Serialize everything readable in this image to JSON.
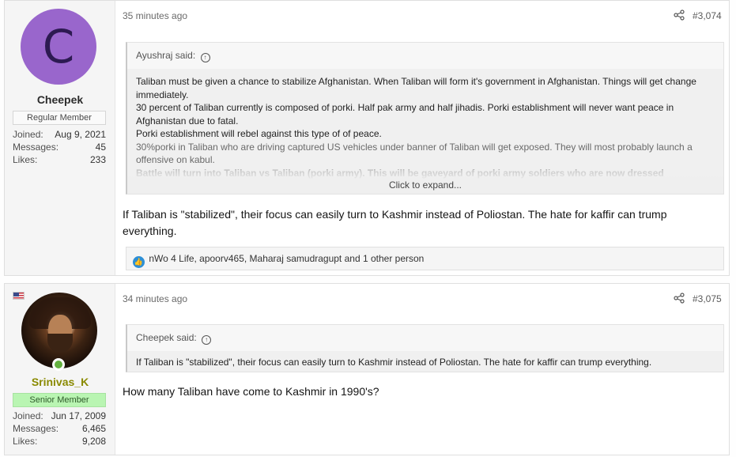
{
  "posts": [
    {
      "author": {
        "avatar_letter": "C",
        "avatar_color": "#9966cc",
        "username": "Cheepek",
        "title": "Regular Member",
        "joined_label": "Joined:",
        "joined": "Aug 9, 2021",
        "messages_label": "Messages:",
        "messages": "45",
        "likes_label": "Likes:",
        "likes": "233"
      },
      "time": "35 minutes ago",
      "post_number": "#3,074",
      "quote": {
        "attribution": "Ayushraj said:",
        "lines": [
          "Taliban must be given a chance to stabilize Afghanistan. When Taliban will form it's government in Afghanistan. Things will get change immediately.",
          "30 percent of Taliban currently is composed of porki. Half pak army and half jihadis. Porki establishment will never want peace in Afghanistan due to fatal.",
          "Porki establishment will rebel against this type of of peace.",
          "30%porki in Taliban who are driving captured US vehicles under banner of Taliban will get exposed. They will most probably launch a offensive on kabul.",
          "Battle will turn into Taliban vs Taliban (porki army). This will be gaveyard of porki army soldiers who are now dressed"
        ],
        "expand_label": "Click to expand..."
      },
      "message": "If Taliban is \"stabilized\", their focus can easily turn to Kashmir instead of Poliostan. The hate for kaffir can trump everything.",
      "reactions": "nWo 4 Life, apoorv465, Maharaj samudragupt and 1 other person"
    },
    {
      "author": {
        "username": "Srinivas_K",
        "username_color": "#8a8a00",
        "title": "Senior Member",
        "title_bg": "#b9f5b2",
        "joined_label": "Joined:",
        "joined": "Jun 17, 2009",
        "messages_label": "Messages:",
        "messages": "6,465",
        "likes_label": "Likes:",
        "likes": "9,208",
        "flag": "us-flag-icon"
      },
      "time": "34 minutes ago",
      "post_number": "#3,075",
      "quote": {
        "attribution": "Cheepek said:",
        "text": "If Taliban is \"stabilized\", their focus can easily turn to Kashmir instead of Poliostan. The hate for kaffir can trump everything."
      },
      "message": "How many Taliban have come to Kashmir in 1990's?"
    }
  ]
}
